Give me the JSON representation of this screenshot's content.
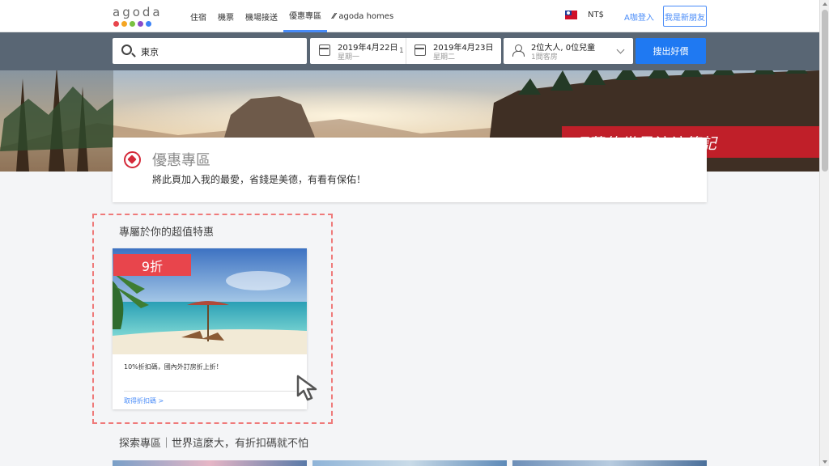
{
  "brand": {
    "logo_text": "agoda",
    "dot_colors": [
      "#e8454c",
      "#f5a623",
      "#7ac142",
      "#8a4bc9",
      "#3b82f6"
    ]
  },
  "nav": {
    "items": [
      {
        "label": "住宿",
        "active": false
      },
      {
        "label": "機票",
        "active": false
      },
      {
        "label": "機場接送",
        "active": false
      },
      {
        "label": "優惠專區",
        "active": true
      },
      {
        "label": "agoda homes",
        "active": false
      }
    ],
    "currency": "NT$",
    "login": "A咖登入",
    "signup": "我是新朋友"
  },
  "search": {
    "destination": "東京",
    "checkin": {
      "date": "2019年4月22日",
      "weekday": "星期一"
    },
    "nights": "1",
    "checkout": {
      "date": "2019年4月23日",
      "weekday": "星期二"
    },
    "guests": {
      "summary": "2位大人, 0位兒童",
      "rooms": "1間客房"
    },
    "button": "搜出好價"
  },
  "watermark": "巧莉的世界流浪筆記",
  "deals": {
    "title": "優惠專區",
    "subtitle": "將此頁加入我的最愛，省錢是美德，有看有保佑！"
  },
  "exclusive": {
    "title": "專屬於你的超值特惠",
    "offer": {
      "badge": "9折",
      "description": "10%折扣碼，國內外訂房折上折！",
      "link": "取得折扣碼 >"
    }
  },
  "explore": {
    "title": "探索專區｜世界這麼大，有折扣碼就不怕"
  },
  "colors": {
    "accent_blue": "#1f79f2",
    "search_bg": "#596674",
    "deal_red": "#e8454c",
    "highlight_border": "#ef7a7a"
  }
}
